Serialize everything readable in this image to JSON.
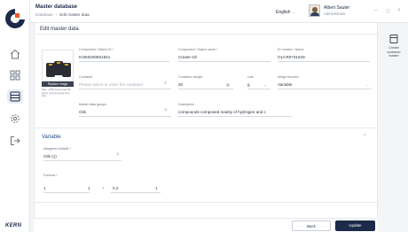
{
  "app": {
    "title": "Master database",
    "breadcrumb": [
      "Database",
      "Edit master data"
    ]
  },
  "header": {
    "language": "English",
    "user_name": "Albert Sauter",
    "user_role": "Administrator"
  },
  "brand": {
    "wordmark": "KERN"
  },
  "page": {
    "section_title": "Edit master data"
  },
  "image_card": {
    "replace_label": "Replace image",
    "hint": "Max. 1MB Supported file types: png jpg jpeg bmp heic"
  },
  "fields": {
    "component_id": {
      "label": "Component / Object ID *",
      "value": "IC060200661921"
    },
    "component_name": {
      "label": "Component / Object name *",
      "value": "Create Oil"
    },
    "id_number": {
      "label": "ID number / Name",
      "value": "OLCR0731629"
    },
    "container": {
      "label": "Container",
      "placeholder": "Please select or enter the container"
    },
    "container_weight": {
      "label": "Container weight",
      "value": "20"
    },
    "unit": {
      "label": "Unit",
      "value": "g"
    },
    "weigh_function": {
      "label": "Weigh function",
      "value": "Variable"
    },
    "master_data_groups": {
      "label": "Master data groups",
      "value": "Oils"
    },
    "description": {
      "label": "Description",
      "value": "compounds composed mainly of hydrogen and c"
    },
    "assigned_variable": {
      "label": "Assigned variable *",
      "value": "Oils (1)"
    },
    "formula": {
      "label": "Formula *",
      "a": "1",
      "op": "×",
      "b": "0.2",
      "c": "1"
    }
  },
  "variable_section": {
    "title": "Variable"
  },
  "buttons": {
    "back": "Back",
    "update": "Update"
  },
  "side_panel": {
    "create_label": "Create container master"
  },
  "colors": {
    "primary": "#1b2a48",
    "accent": "#1f4a8a"
  }
}
